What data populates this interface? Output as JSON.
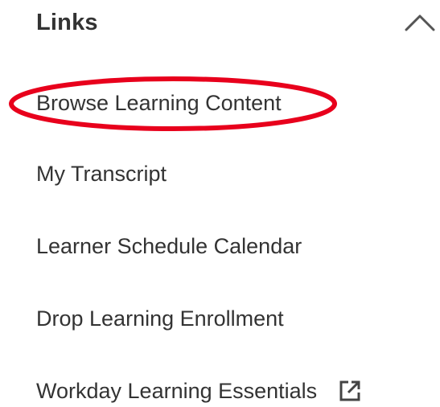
{
  "section": {
    "title": "Links",
    "expanded": true,
    "toggle_icon": "chevron-up-icon"
  },
  "links": [
    {
      "label": "Browse Learning Content",
      "highlighted": true
    },
    {
      "label": "My Transcript"
    },
    {
      "label": "Learner Schedule Calendar"
    },
    {
      "label": "Drop Learning Enrollment"
    },
    {
      "label": "Workday Learning Essentials",
      "icon": "external-link-icon"
    }
  ],
  "colors": {
    "text": "#333333",
    "highlight_annotation": "#e8001c"
  }
}
